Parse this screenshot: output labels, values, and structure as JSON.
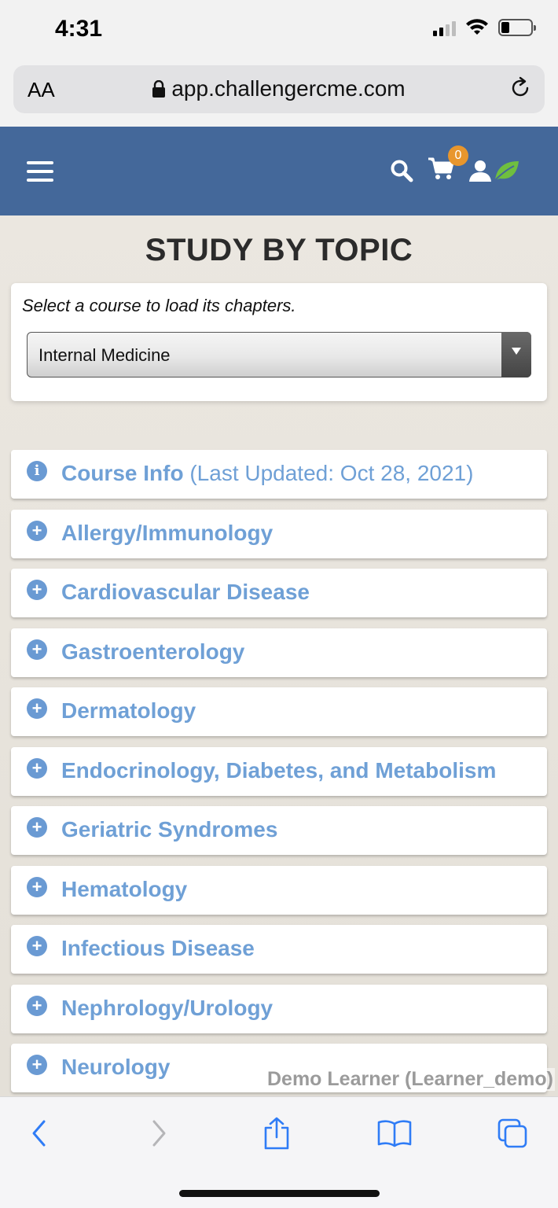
{
  "status_bar": {
    "time": "4:31"
  },
  "browser": {
    "text_size": "AA",
    "url": "app.challengercme.com"
  },
  "header": {
    "cart_count": "0"
  },
  "page": {
    "title": "STUDY BY TOPIC",
    "select_hint": "Select a course to load its chapters.",
    "course_selected": "Internal Medicine"
  },
  "topics": [
    {
      "label": "Course Info",
      "extra": "(Last Updated: Oct 28, 2021)",
      "icon": "info-icon"
    },
    {
      "label": "Allergy/Immunology",
      "icon": "plus-circle-icon"
    },
    {
      "label": "Cardiovascular Disease",
      "icon": "plus-circle-icon"
    },
    {
      "label": "Gastroenterology",
      "icon": "plus-circle-icon"
    },
    {
      "label": "Dermatology",
      "icon": "plus-circle-icon"
    },
    {
      "label": "Endocrinology, Diabetes, and Metabolism",
      "icon": "plus-circle-icon"
    },
    {
      "label": "Geriatric Syndromes",
      "icon": "plus-circle-icon"
    },
    {
      "label": "Hematology",
      "icon": "plus-circle-icon"
    },
    {
      "label": "Infectious Disease",
      "icon": "plus-circle-icon"
    },
    {
      "label": "Nephrology/Urology",
      "icon": "plus-circle-icon"
    },
    {
      "label": "Neurology",
      "icon": "plus-circle-icon"
    }
  ],
  "watermark": "Demo Learner (Learner_demo)",
  "colors": {
    "header_bg": "#44689a",
    "topic_text": "#6fa0d6",
    "badge": "#e8962d",
    "leaf": "#6fbf3f"
  }
}
